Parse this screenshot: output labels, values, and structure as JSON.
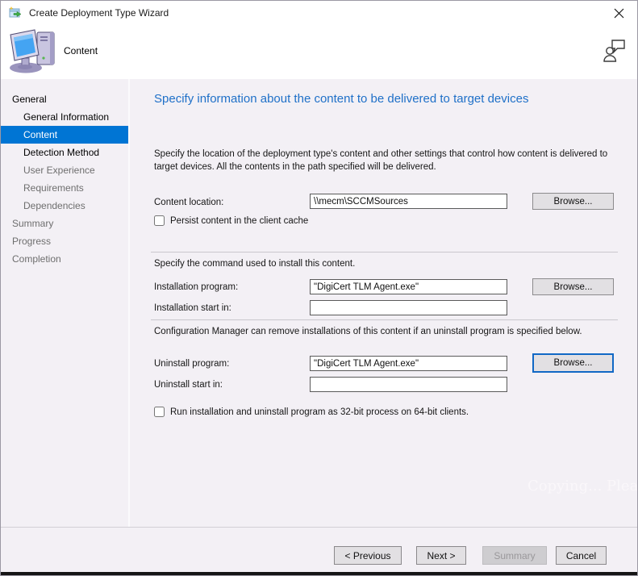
{
  "window": {
    "title": "Create Deployment Type Wizard"
  },
  "icons": {
    "titlebar": "wizard-icon",
    "close": "close-icon",
    "page": "computer-icon",
    "help": "feedback-person-icon"
  },
  "header": {
    "page_label": "Content"
  },
  "sidebar": {
    "items": [
      {
        "label": "General",
        "level": 0,
        "state": "active"
      },
      {
        "label": "General Information",
        "level": 1,
        "state": "active"
      },
      {
        "label": "Content",
        "level": 1,
        "state": "selected"
      },
      {
        "label": "Detection Method",
        "level": 1,
        "state": "active"
      },
      {
        "label": "User Experience",
        "level": 1,
        "state": "upcoming"
      },
      {
        "label": "Requirements",
        "level": 1,
        "state": "upcoming"
      },
      {
        "label": "Dependencies",
        "level": 1,
        "state": "upcoming"
      },
      {
        "label": "Summary",
        "level": 0,
        "state": "upcoming"
      },
      {
        "label": "Progress",
        "level": 0,
        "state": "upcoming"
      },
      {
        "label": "Completion",
        "level": 0,
        "state": "upcoming"
      }
    ]
  },
  "main": {
    "heading": "Specify information about the content to be delivered to target devices",
    "intro": "Specify the location of the deployment type's content and other settings that control how content is delivered to target devices. All the contents in the path specified will be delivered.",
    "content_location": {
      "label": "Content location:",
      "value": "\\\\mecm\\SCCMSources",
      "browse": "Browse..."
    },
    "persist_checkbox": {
      "label": "Persist content in the client cache",
      "checked": false
    },
    "install_section_note": "Specify the command used to install this content.",
    "installation_program": {
      "label": "Installation program:",
      "value": "\"DigiCert TLM Agent.exe\"",
      "browse": "Browse..."
    },
    "installation_start_in": {
      "label": "Installation start in:",
      "value": ""
    },
    "uninstall_section_note": "Configuration Manager can remove installations of this content if an uninstall program is specified below.",
    "uninstall_program": {
      "label": "Uninstall program:",
      "value": "\"DigiCert TLM Agent.exe\"",
      "browse": "Browse..."
    },
    "uninstall_start_in": {
      "label": "Uninstall start in:",
      "value": ""
    },
    "run_32bit_checkbox": {
      "label": "Run installation and uninstall program as 32-bit process on 64-bit clients.",
      "checked": false
    }
  },
  "footer": {
    "previous": "< Previous",
    "next": "Next >",
    "summary": "Summary",
    "cancel": "Cancel"
  },
  "watermark": "Copying... Please try"
}
